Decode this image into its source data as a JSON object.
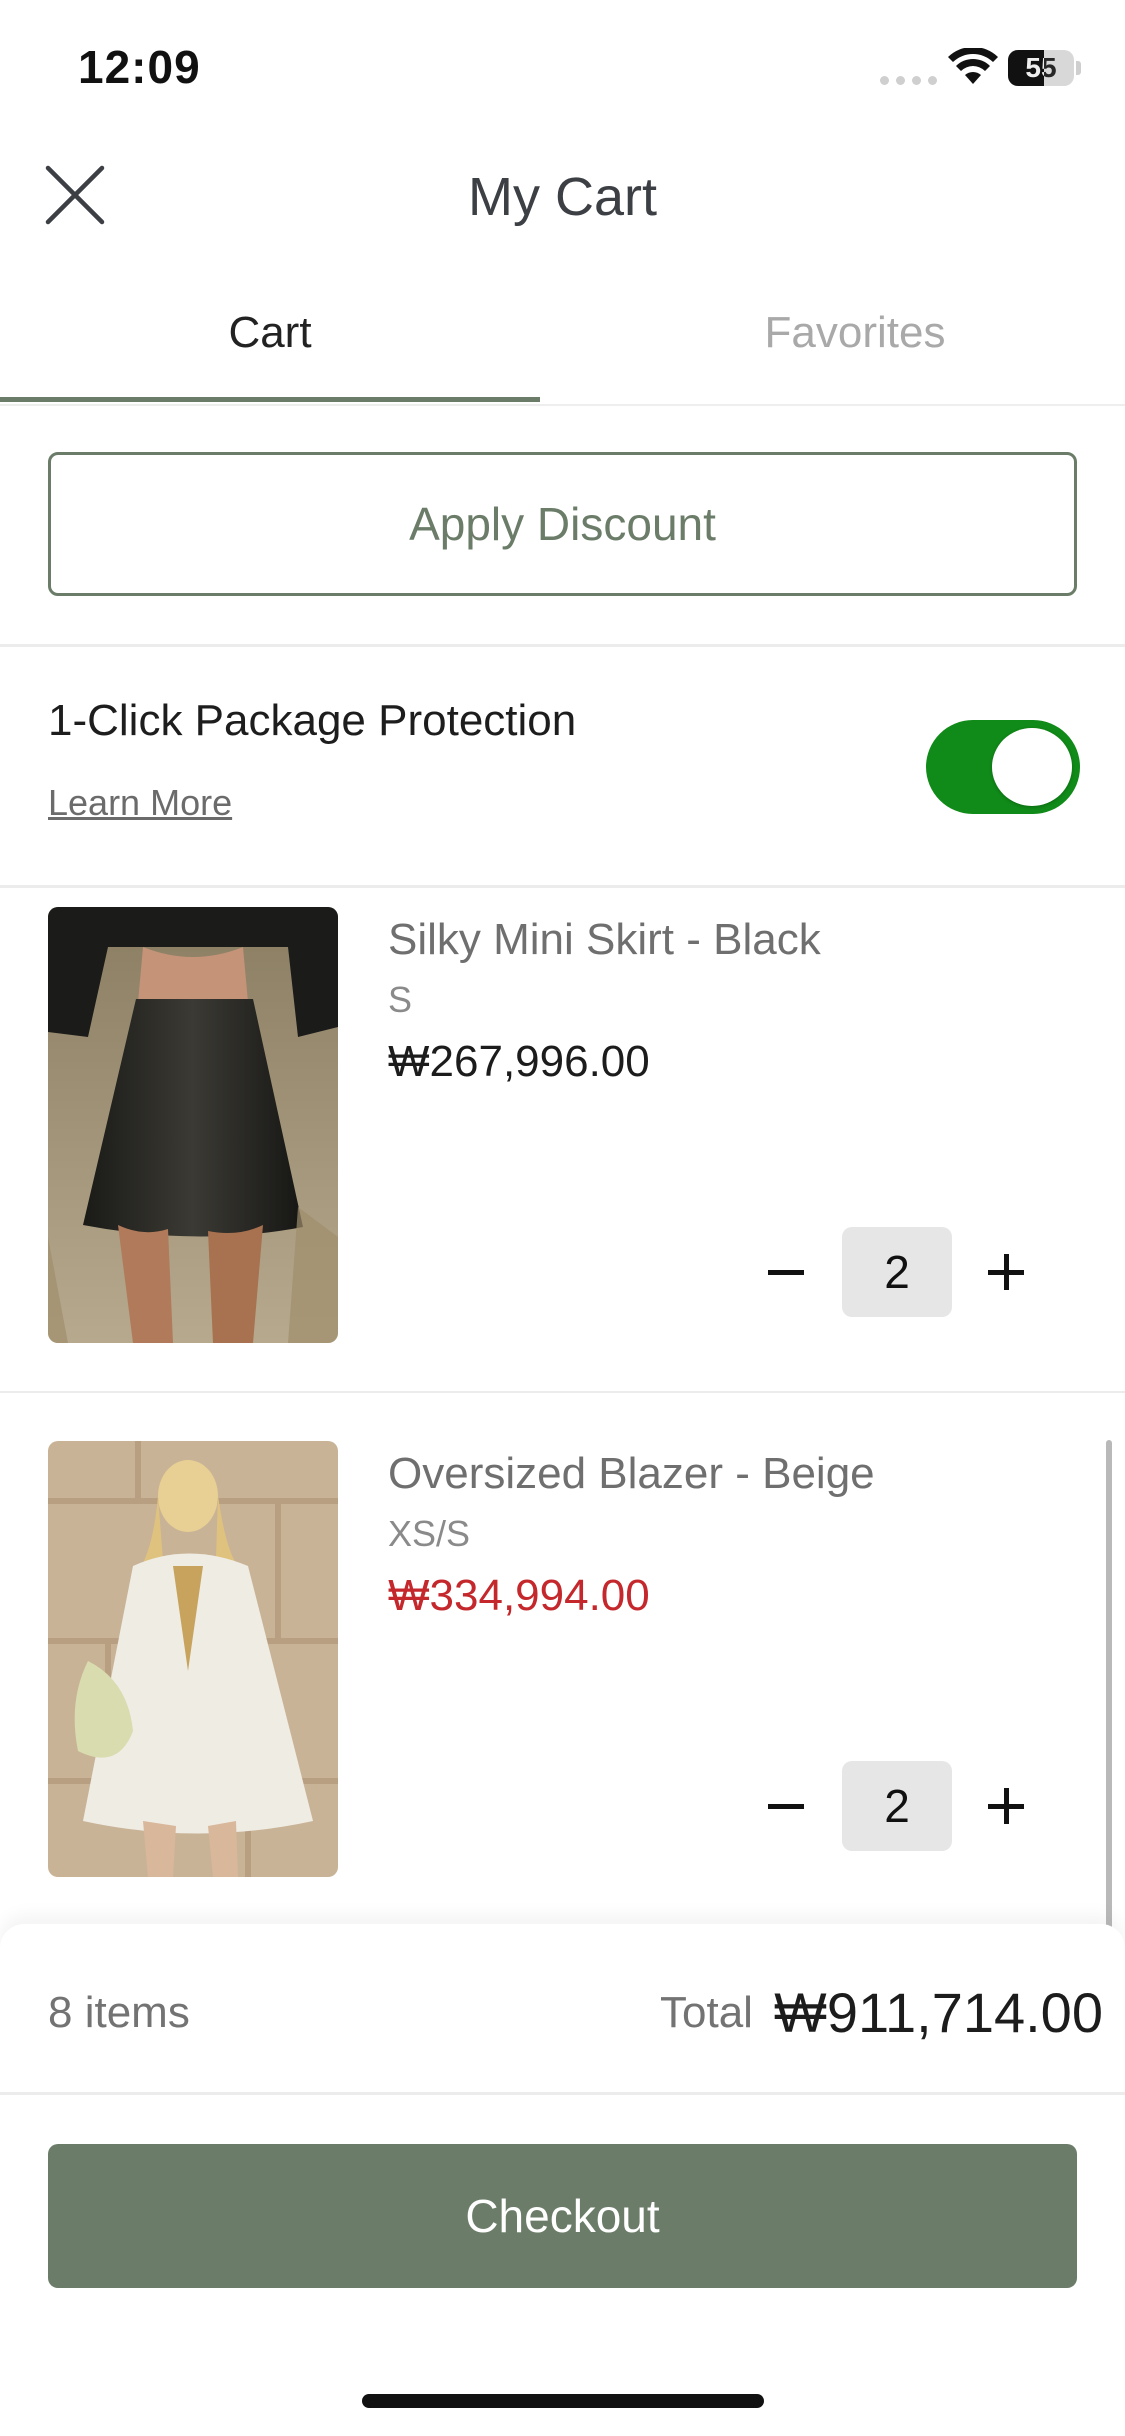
{
  "status_bar": {
    "time": "12:09",
    "battery_level": "55",
    "icons": [
      "signal-dots-icon",
      "wifi-icon",
      "battery-icon"
    ]
  },
  "header": {
    "title": "My Cart",
    "close_icon": "close-icon"
  },
  "tabs": [
    {
      "label": "Cart",
      "active": true
    },
    {
      "label": "Favorites",
      "active": false
    }
  ],
  "discount": {
    "label": "Apply Discount"
  },
  "protection": {
    "title": "1-Click Package Protection",
    "link": "Learn More",
    "enabled": true
  },
  "items": [
    {
      "name": "Silky Mini Skirt - Black",
      "size": "S",
      "price": "₩267,996.00",
      "price_color": "#1c1c1c",
      "quantity": "2"
    },
    {
      "name": "Oversized Blazer - Beige",
      "size": "XS/S",
      "price": "₩334,994.00",
      "price_color": "#c4282c",
      "quantity": "2"
    }
  ],
  "summary": {
    "items_count": "8 items",
    "total_label": "Total",
    "total_value": "₩911,714.00"
  },
  "checkout": {
    "label": "Checkout"
  },
  "colors": {
    "accent": "#6b7d69",
    "toggle_on": "#108a18",
    "sale_price": "#c4282c"
  }
}
